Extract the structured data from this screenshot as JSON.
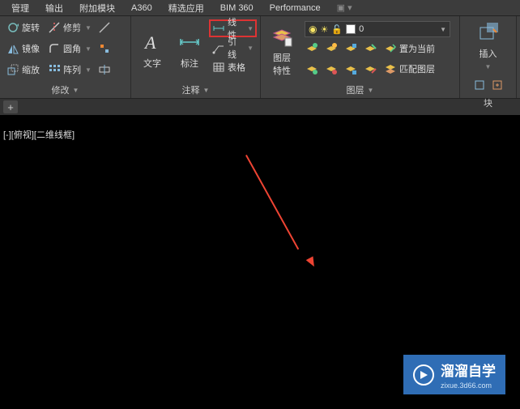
{
  "menubar": {
    "items": [
      "管理",
      "输出",
      "附加模块",
      "A360",
      "精选应用",
      "BIM 360",
      "Performance"
    ]
  },
  "ribbon": {
    "modify_panel": {
      "title": "修改",
      "rotate": "旋转",
      "trim": "修剪",
      "mirror": "镜像",
      "fillet": "圆角",
      "scale": "缩放",
      "array": "阵列"
    },
    "text_panel": {
      "text": "文字",
      "dimension": "标注",
      "linear": "线性",
      "leader": "引线",
      "table": "表格",
      "title": "注释"
    },
    "layer_panel": {
      "props": "图层\n特性",
      "layer_value": "0",
      "set_current": "置为当前",
      "match_layer": "匹配图层",
      "title": "图层"
    },
    "block_panel": {
      "insert": "插入",
      "title": "块"
    }
  },
  "viewport": {
    "label": "[-][俯视][二维线框]"
  },
  "watermark": {
    "text": "溜溜自学",
    "url": "zixue.3d66.com"
  }
}
